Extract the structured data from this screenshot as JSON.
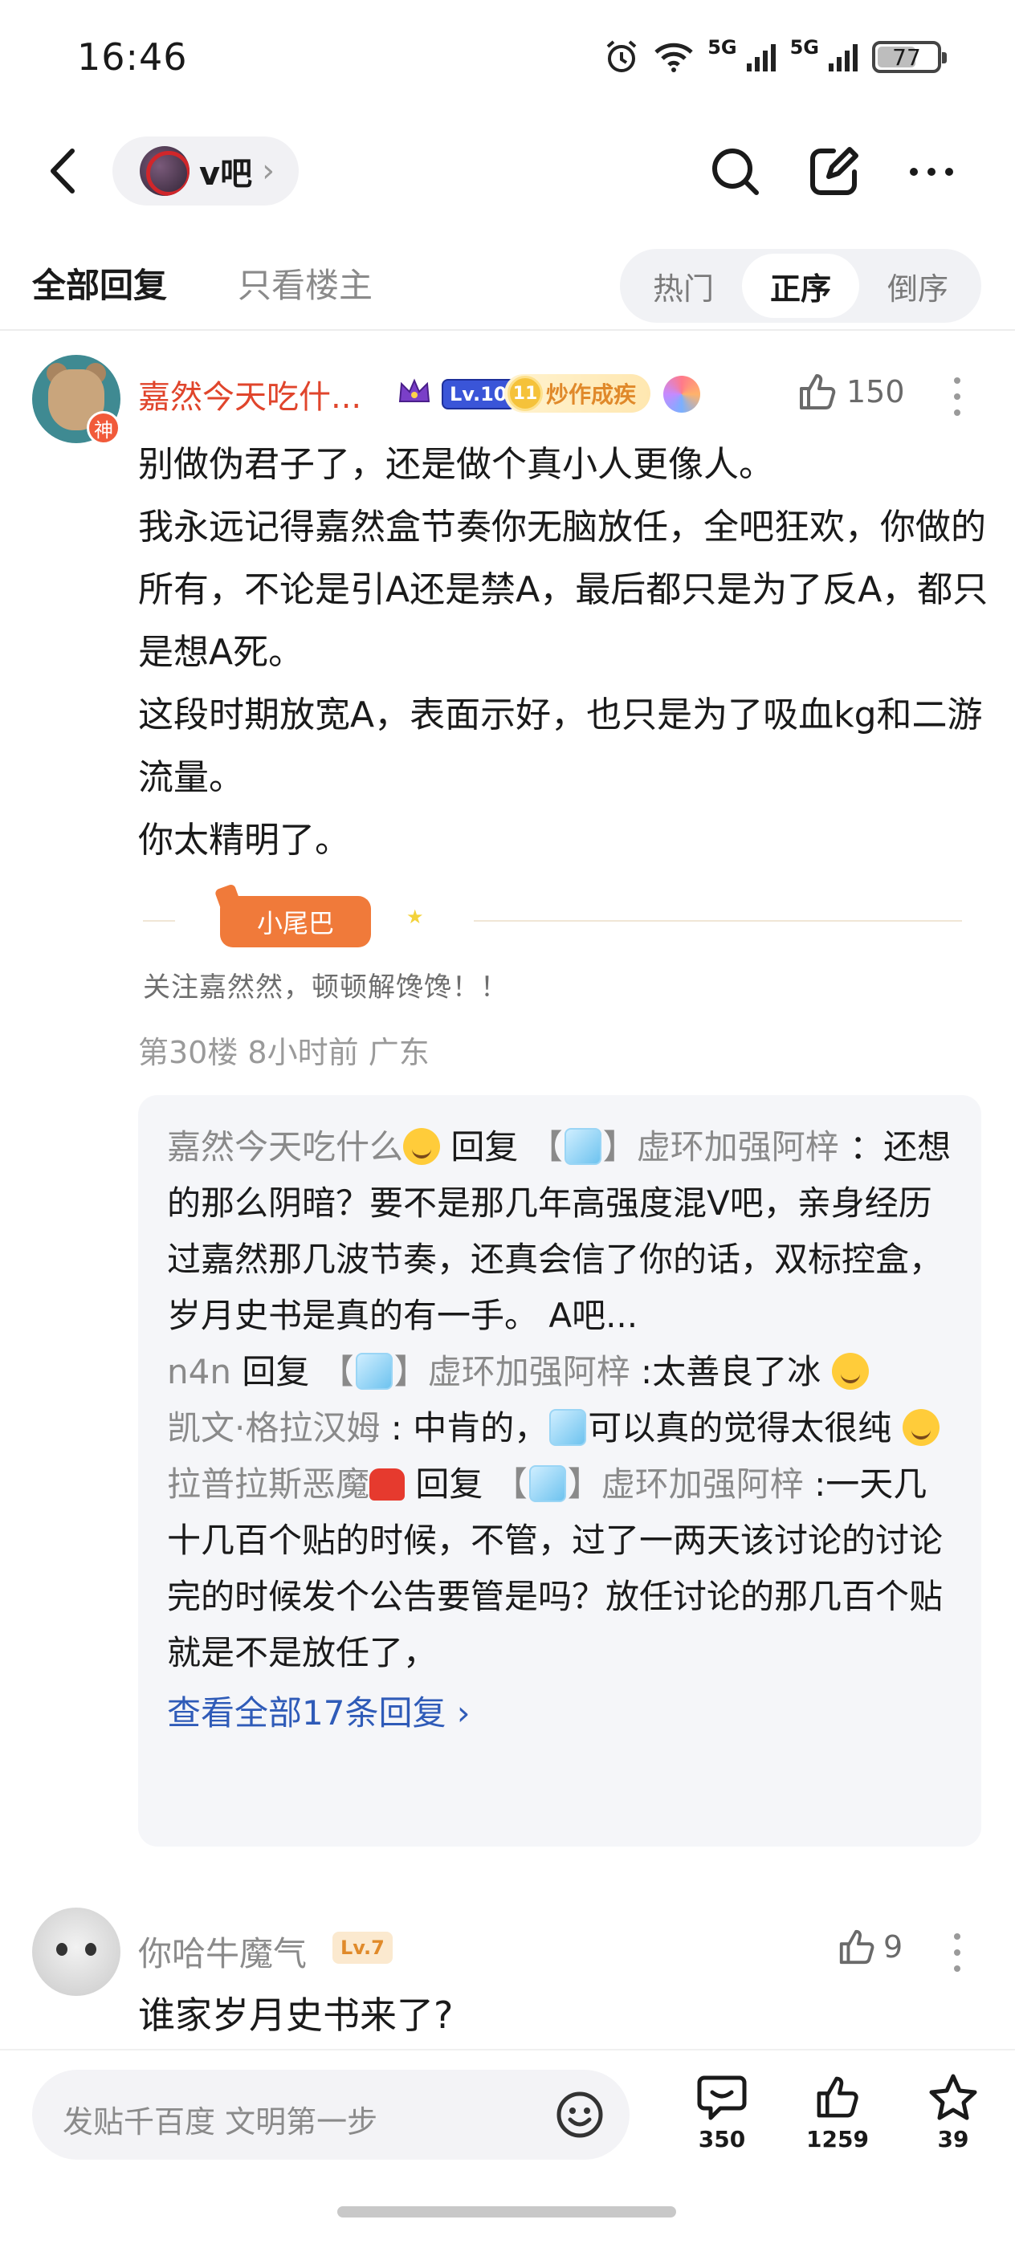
{
  "status_bar": {
    "time": "16:46",
    "signal1": "5G",
    "signal2": "5G",
    "battery": "77"
  },
  "header": {
    "forum_name": "v吧"
  },
  "tabs": {
    "all_replies": "全部回复",
    "owner_only": "只看楼主",
    "sort": [
      "热门",
      "正序",
      "倒序"
    ],
    "active_sort": "正序"
  },
  "post": {
    "author": "嘉然今天吃什...",
    "god_badge": "神",
    "level": "Lv.10",
    "title_level": "11",
    "title": "炒作成疾",
    "likes": "150",
    "body": [
      "别做伪君子了，还是做个真小人更像人。",
      "我永远记得嘉然盒节奏你无脑放任，全吧狂欢，你做的所有，不论是引A还是禁A，最后都只是为了反A，都只是想A死。",
      "这段时期放宽A，表面示好，也只是为了吸血kg和二游流量。",
      "你太精明了。"
    ],
    "tail_badge": "小尾巴",
    "tail_text": "关注嘉然然，顿顿解馋馋！！",
    "meta": "第30楼 8小时前 广东",
    "replies": [
      {
        "name": "嘉然今天吃什么",
        "connector": " 回复 ",
        "target_pre": "【",
        "target_post": "】虚环加强阿梓",
        "text": " ：还想的那么阴暗？要不是那几年高强度混V吧，亲身经历过嘉然那几波节奏，还真会信了你的话，双标控盒，岁月史书是真的有一手。 A吧..."
      },
      {
        "name": "n4n",
        "connector": " 回复 ",
        "target_pre": "【",
        "target_post": "】虚环加强阿梓",
        "text": " :太善良了冰 "
      },
      {
        "name": "凯文·格拉汉姆",
        "text_pre": " : 中肯的，",
        "text_post": "可以真的觉得太很纯 "
      },
      {
        "name": "拉普拉斯恶魔",
        "connector": " 回复 ",
        "target_pre": "【",
        "target_post": "】虚环加强阿梓",
        "text": " :一天几十几百个贴的时候，不管，过了一两天该讨论的讨论完的时候发个公告要管是吗？放任讨论的那几百个贴就是不是放任了，"
      }
    ],
    "view_all": "查看全部17条回复 ›"
  },
  "comment2": {
    "author": "你哈牛魔气",
    "level": "Lv.7",
    "likes": "9",
    "body": "谁家岁月史书来了?"
  },
  "bottom": {
    "input_placeholder": "发贴千百度 文明第一步",
    "comments": "350",
    "likes": "1259",
    "stars": "39"
  },
  "colors": {
    "author_red": "#e0452c",
    "link_blue": "#2f5bb8",
    "reply_bg": "#f5f6f9"
  }
}
